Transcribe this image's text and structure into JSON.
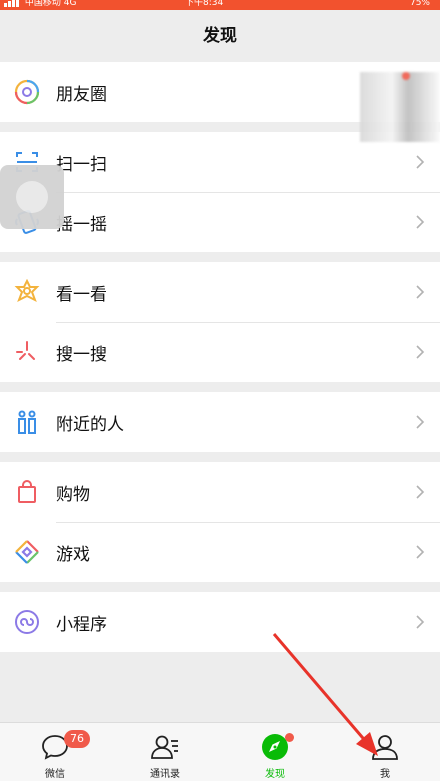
{
  "status": {
    "carrier": "中国移动",
    "network": "4G",
    "time": "下午8:34",
    "battery": "75%"
  },
  "nav": {
    "title": "发现"
  },
  "groups": [
    {
      "items": [
        {
          "label": "朋友圈",
          "icon": "moments-icon"
        }
      ]
    },
    {
      "items": [
        {
          "label": "扫一扫",
          "icon": "scan-icon"
        },
        {
          "label": "摇一摇",
          "icon": "shake-icon"
        }
      ]
    },
    {
      "items": [
        {
          "label": "看一看",
          "icon": "top-stories-icon"
        },
        {
          "label": "搜一搜",
          "icon": "search-icon"
        }
      ]
    },
    {
      "items": [
        {
          "label": "附近的人",
          "icon": "people-nearby-icon"
        }
      ]
    },
    {
      "items": [
        {
          "label": "购物",
          "icon": "shopping-bag-icon"
        },
        {
          "label": "游戏",
          "icon": "games-icon"
        }
      ]
    },
    {
      "items": [
        {
          "label": "小程序",
          "icon": "mini-programs-icon"
        }
      ]
    }
  ],
  "tabbar": {
    "tabs": [
      {
        "label": "微信",
        "icon": "chat-bubble-icon",
        "badge": "76"
      },
      {
        "label": "通讯录",
        "icon": "contacts-icon"
      },
      {
        "label": "发现",
        "icon": "discover-compass-icon",
        "active": true
      },
      {
        "label": "我",
        "icon": "me-person-icon"
      }
    ]
  },
  "colors": {
    "accent": "#09bb07",
    "badge": "#f05a4a",
    "status_bar": "#f2522e",
    "annotation_arrow": "#e8332a"
  }
}
